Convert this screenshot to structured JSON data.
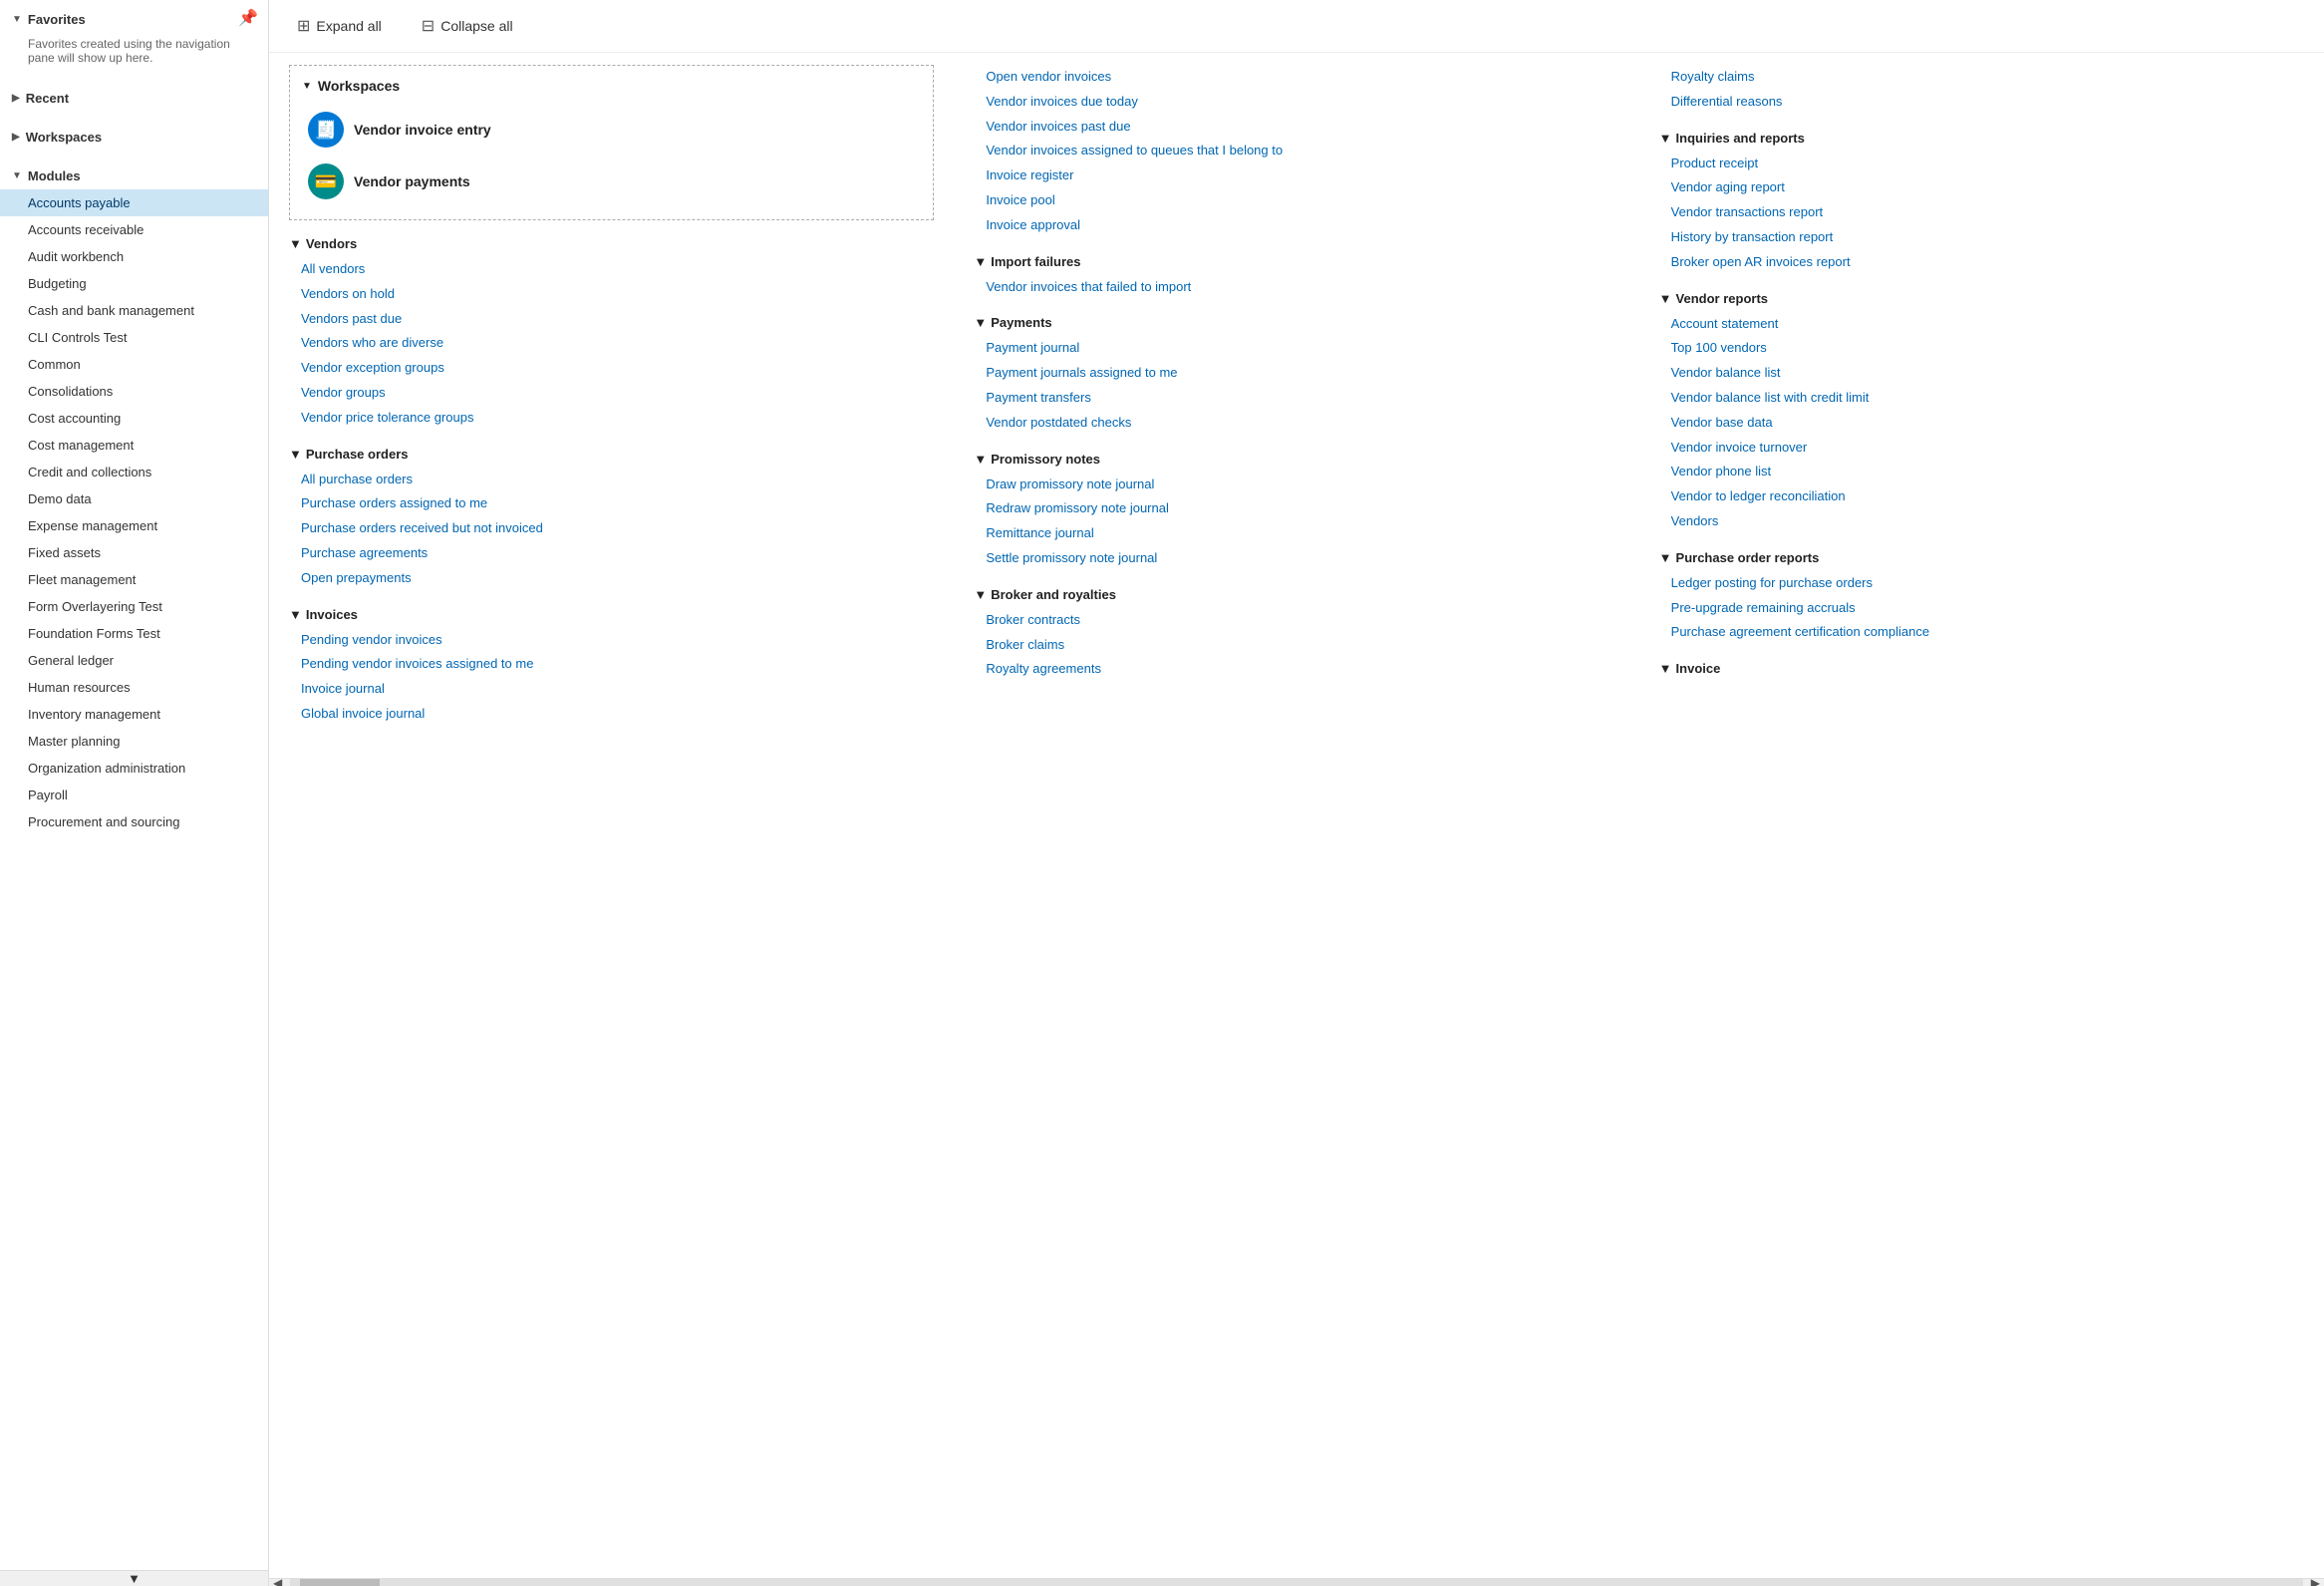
{
  "sidebar": {
    "pin_icon": "📌",
    "sections": [
      {
        "id": "favorites",
        "label": "Favorites",
        "expanded": true,
        "description": "Favorites created using the navigation pane will show up here.",
        "items": []
      },
      {
        "id": "recent",
        "label": "Recent",
        "expanded": false,
        "items": []
      },
      {
        "id": "workspaces",
        "label": "Workspaces",
        "expanded": false,
        "items": []
      },
      {
        "id": "modules",
        "label": "Modules",
        "expanded": true,
        "items": [
          {
            "id": "accounts-payable",
            "label": "Accounts payable",
            "active": true
          },
          {
            "id": "accounts-receivable",
            "label": "Accounts receivable",
            "active": false
          },
          {
            "id": "audit-workbench",
            "label": "Audit workbench",
            "active": false
          },
          {
            "id": "budgeting",
            "label": "Budgeting",
            "active": false
          },
          {
            "id": "cash-bank",
            "label": "Cash and bank management",
            "active": false
          },
          {
            "id": "cli-controls",
            "label": "CLI Controls Test",
            "active": false
          },
          {
            "id": "common",
            "label": "Common",
            "active": false
          },
          {
            "id": "consolidations",
            "label": "Consolidations",
            "active": false
          },
          {
            "id": "cost-accounting",
            "label": "Cost accounting",
            "active": false
          },
          {
            "id": "cost-management",
            "label": "Cost management",
            "active": false
          },
          {
            "id": "credit-collections",
            "label": "Credit and collections",
            "active": false
          },
          {
            "id": "demo-data",
            "label": "Demo data",
            "active": false
          },
          {
            "id": "expense-management",
            "label": "Expense management",
            "active": false
          },
          {
            "id": "fixed-assets",
            "label": "Fixed assets",
            "active": false
          },
          {
            "id": "fleet-management",
            "label": "Fleet management",
            "active": false
          },
          {
            "id": "form-overlayering",
            "label": "Form Overlayering Test",
            "active": false
          },
          {
            "id": "foundation-forms",
            "label": "Foundation Forms Test",
            "active": false
          },
          {
            "id": "general-ledger",
            "label": "General ledger",
            "active": false
          },
          {
            "id": "human-resources",
            "label": "Human resources",
            "active": false
          },
          {
            "id": "inventory-management",
            "label": "Inventory management",
            "active": false
          },
          {
            "id": "master-planning",
            "label": "Master planning",
            "active": false
          },
          {
            "id": "org-admin",
            "label": "Organization administration",
            "active": false
          },
          {
            "id": "payroll",
            "label": "Payroll",
            "active": false
          },
          {
            "id": "procurement",
            "label": "Procurement and sourcing",
            "active": false
          }
        ]
      }
    ]
  },
  "toolbar": {
    "expand_all": "Expand all",
    "collapse_all": "Collapse all"
  },
  "workspaces_section": {
    "title": "Workspaces",
    "items": [
      {
        "id": "vendor-invoice-entry",
        "label": "Vendor invoice entry",
        "icon": "🧾",
        "color": "blue"
      },
      {
        "id": "vendor-payments",
        "label": "Vendor payments",
        "icon": "💳",
        "color": "teal"
      }
    ]
  },
  "col1": {
    "vendors": {
      "title": "Vendors",
      "links": [
        "All vendors",
        "Vendors on hold",
        "Vendors past due",
        "Vendors who are diverse",
        "Vendor exception groups",
        "Vendor groups",
        "Vendor price tolerance groups"
      ]
    },
    "purchase_orders": {
      "title": "Purchase orders",
      "links": [
        "All purchase orders",
        "Purchase orders assigned to me",
        "Purchase orders received but not invoiced",
        "Purchase agreements",
        "Open prepayments"
      ]
    },
    "invoices": {
      "title": "Invoices",
      "links": [
        "Pending vendor invoices",
        "Pending vendor invoices assigned to me",
        "Invoice journal",
        "Global invoice journal"
      ]
    }
  },
  "col2": {
    "open_invoices": {
      "links": [
        "Open vendor invoices",
        "Vendor invoices due today",
        "Vendor invoices past due",
        "Vendor invoices assigned to queues that I belong to",
        "Invoice register",
        "Invoice pool",
        "Invoice approval"
      ]
    },
    "import_failures": {
      "title": "Import failures",
      "links": [
        "Vendor invoices that failed to import"
      ]
    },
    "payments": {
      "title": "Payments",
      "links": [
        "Payment journal",
        "Payment journals assigned to me",
        "Payment transfers",
        "Vendor postdated checks"
      ]
    },
    "promissory_notes": {
      "title": "Promissory notes",
      "links": [
        "Draw promissory note journal",
        "Redraw promissory note journal",
        "Remittance journal",
        "Settle promissory note journal"
      ]
    },
    "broker_royalties": {
      "title": "Broker and royalties",
      "links": [
        "Broker contracts",
        "Broker claims",
        "Royalty agreements"
      ]
    }
  },
  "col3": {
    "top_links": [
      "Royalty claims",
      "Differential reasons"
    ],
    "inquiries_reports": {
      "title": "Inquiries and reports",
      "links": [
        "Product receipt",
        "Vendor aging report",
        "Vendor transactions report",
        "History by transaction report",
        "Broker open AR invoices report"
      ]
    },
    "vendor_reports": {
      "title": "Vendor reports",
      "links": [
        "Account statement",
        "Top 100 vendors",
        "Vendor balance list",
        "Vendor balance list with credit limit",
        "Vendor base data",
        "Vendor invoice turnover",
        "Vendor phone list",
        "Vendor to ledger reconciliation",
        "Vendors"
      ]
    },
    "purchase_order_reports": {
      "title": "Purchase order reports",
      "links": [
        "Ledger posting for purchase orders",
        "Pre-upgrade remaining accruals",
        "Purchase agreement certification compliance"
      ]
    },
    "invoice": {
      "title": "Invoice",
      "links": []
    }
  }
}
